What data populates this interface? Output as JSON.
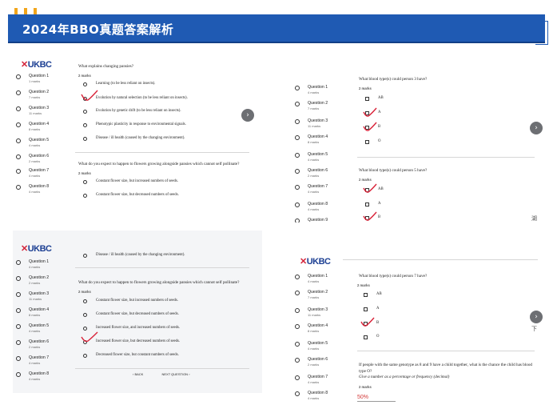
{
  "header": {
    "title": "2024年BBO真题答案解析"
  },
  "brand": {
    "accent": "#1f5ab3",
    "dots": "#f2a51b",
    "tick": "#d9243a",
    "logo_text": "UKBC"
  },
  "panel1": {
    "questions": [
      {
        "label": "Question 1",
        "marks": "1 marks"
      },
      {
        "label": "Question 2",
        "marks": "7 marks"
      },
      {
        "label": "Question 3",
        "marks": "11 marks"
      },
      {
        "label": "Question 4",
        "marks": "8 marks"
      },
      {
        "label": "Question 5",
        "marks": "4 marks"
      },
      {
        "label": "Question 6",
        "marks": "2 marks"
      },
      {
        "label": "Question 7",
        "marks": "4 marks"
      },
      {
        "label": "Question 8",
        "marks": "4 marks"
      }
    ],
    "q1": "What explains changing pansies?",
    "q1_marks": "2 marks",
    "q1_options": [
      "Learning (to be less reliant on insects).",
      "Evolution by natural selection (to be less reliant on insects).",
      "Evolution by genetic drift (to be less reliant on insects).",
      "Phenotypic plasticity in response to environmental signals.",
      "Disease / ill health (caused by the changing environment)."
    ],
    "q2": "What do you expect to happen to flowers growing alongside pansies which cannot self pollinate?",
    "q2_marks": "2 marks",
    "q2_options": [
      "Constant flower size, but increased numbers of seeds.",
      "Constant flower size, but decreased numbers of seeds."
    ]
  },
  "panel2": {
    "questions": [
      {
        "label": "Question 1",
        "marks": "4 marks"
      },
      {
        "label": "Question 2",
        "marks": "2 marks"
      },
      {
        "label": "Question 3",
        "marks": "11 marks"
      },
      {
        "label": "Question 4",
        "marks": "8 marks"
      },
      {
        "label": "Question 5",
        "marks": "4 marks"
      },
      {
        "label": "Question 6",
        "marks": "2 marks"
      },
      {
        "label": "Question 7",
        "marks": "4 marks"
      },
      {
        "label": "Question 8",
        "marks": "4 marks"
      }
    ],
    "top_option": "Disease / ill health (caused by the changing environment).",
    "q": "What do you expect to happen to flowers growing alongside pansies which cannot self pollinate?",
    "q_marks": "2 marks",
    "options": [
      "Constant flower size, but increased numbers of seeds.",
      "Constant flower size, but decreased numbers of seeds.",
      "Increased flower size, and increased numbers of seeds.",
      "Increased flower size, but decreased numbers of seeds.",
      "Decreased flower size, but constant numbers of seeds."
    ],
    "back": "BACK",
    "next": "NEXT QUESTION"
  },
  "panel3": {
    "questions": [
      {
        "label": "Question 1",
        "marks": "4 marks"
      },
      {
        "label": "Question 2",
        "marks": "7 marks"
      },
      {
        "label": "Question 3",
        "marks": "11 marks"
      },
      {
        "label": "Question 4",
        "marks": "8 marks"
      },
      {
        "label": "Question 5",
        "marks": "4 marks"
      },
      {
        "label": "Question 6",
        "marks": "2 marks"
      },
      {
        "label": "Question 7",
        "marks": "4 marks"
      },
      {
        "label": "Question 8",
        "marks": "4 marks"
      },
      {
        "label": "Question 9",
        "marks": ""
      }
    ],
    "qa": "What blood type(s) could person 3 have?",
    "qa_marks": "2 marks",
    "qa_options": [
      "AB",
      "A",
      "B",
      "O"
    ],
    "qb": "What blood type(s) could person 5 have?",
    "qb_marks": "2 marks",
    "qb_options": [
      "AB",
      "A",
      "B"
    ],
    "side_mark": "湖"
  },
  "panel4": {
    "questions": [
      {
        "label": "Question 1",
        "marks": "4 marks"
      },
      {
        "label": "Question 2",
        "marks": "7 marks"
      },
      {
        "label": "Question 3",
        "marks": "11 marks"
      },
      {
        "label": "Question 4",
        "marks": "8 marks"
      },
      {
        "label": "Question 5",
        "marks": "4 marks"
      },
      {
        "label": "Question 6",
        "marks": "2 marks"
      },
      {
        "label": "Question 7",
        "marks": "4 marks"
      },
      {
        "label": "Question 8",
        "marks": "4 marks"
      }
    ],
    "qa": "What blood type(s) could person 7 have?",
    "qa_marks": "2 marks",
    "qa_options": [
      "AB",
      "A",
      "B",
      "O"
    ],
    "qb_line1": "If people with the same genotype as 8 and 9 have a child together, what is the chance the child has blood",
    "qb_line2": "type O?",
    "qb_hint": "Give a number as a percentage or frequency (decimal)",
    "qb_marks": "2 marks",
    "answer": "50%",
    "side_mark": "下"
  }
}
